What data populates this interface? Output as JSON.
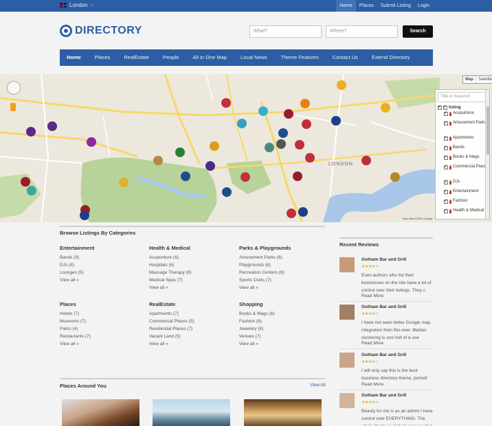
{
  "topbar": {
    "location": "London",
    "links": [
      {
        "label": "Home",
        "active": true
      },
      {
        "label": "Places",
        "active": false
      },
      {
        "label": "Submit Listing",
        "active": false
      },
      {
        "label": "Login",
        "active": false
      }
    ]
  },
  "header": {
    "logo_text": "DIRECTORY",
    "what_placeholder": "What?",
    "where_placeholder": "Where?",
    "search_label": "Search"
  },
  "nav": {
    "items": [
      "Home",
      "Places",
      "RealEstate",
      "People",
      "All In One Map",
      "Local News",
      "Theme Features",
      "Contact Us",
      "Extend Directory"
    ]
  },
  "map": {
    "type_map": "Map",
    "type_satellite": "Satellite",
    "filter_placeholder": "Title or Keyword",
    "filter_root": "listing",
    "filter_items": [
      "Acupunture",
      "Amusement Parks",
      "Apartments",
      "Bands",
      "Books & Mags",
      "Commercial Places",
      "DJs",
      "Entertainment",
      "Fashion",
      "Health & Medical"
    ],
    "area_label": "LONDON",
    "credit": "Map data ©2013 Google",
    "colors": {
      "water": "#a9c7e8",
      "park": "#b8d39a",
      "land": "#ede8dd",
      "road_major": "#f7d86a"
    }
  },
  "browse": {
    "title": "Browse Listings By Categories",
    "view_all": "View all »",
    "categories": [
      {
        "name": "Entertainment",
        "items": [
          "Bands (9)",
          "DJs (8)",
          "Lounges (5)"
        ]
      },
      {
        "name": "Health & Medical",
        "items": [
          "Acupunture (6)",
          "Hospitals (6)",
          "Massage Therapy (6)",
          "Medical Spas (7)"
        ]
      },
      {
        "name": "Parks & Playgrounds",
        "items": [
          "Amusement Parks (6)",
          "Playgrounds (6)",
          "Recreation Centers (6)",
          "Sports Clubs (7)"
        ]
      },
      {
        "name": "Places",
        "items": [
          "Hotels (7)",
          "Museums (7)",
          "Parks (4)",
          "Restaurants (7)"
        ]
      },
      {
        "name": "RealEstate",
        "items": [
          "Apartments (7)",
          "Commercial Places (5)",
          "Residential Places (7)",
          "Vacant Land (5)"
        ]
      },
      {
        "name": "Shopping",
        "items": [
          "Books & Mags (6)",
          "Fashion (6)",
          "Jewelery (6)",
          "Venues (7)"
        ]
      }
    ]
  },
  "reviews": {
    "title": "Recent Reviews",
    "read_more": "Read More",
    "stars": "★★★★★",
    "items": [
      {
        "name": "Gotham Bar and Grill",
        "text": "Even authors who list their businesses on the site have a lot of control over their listings. They c",
        "rating": 4
      },
      {
        "name": "Gotham Bar and Grill",
        "text": "I have not seen better Google map integration then this ever. Marker clustering is one hell of a use",
        "rating": 4
      },
      {
        "name": "Gotham Bar and Grill",
        "text": "I will only say this is the best business directory theme, period!",
        "rating": 4
      },
      {
        "name": "Gotham Bar and Grill",
        "text": "Beauty for me is as an admin I have control over EVERYTHING. The whole theme is etched away so that",
        "rating": 4
      }
    ]
  },
  "around": {
    "title": "Places Around You",
    "view_all": "View All"
  }
}
